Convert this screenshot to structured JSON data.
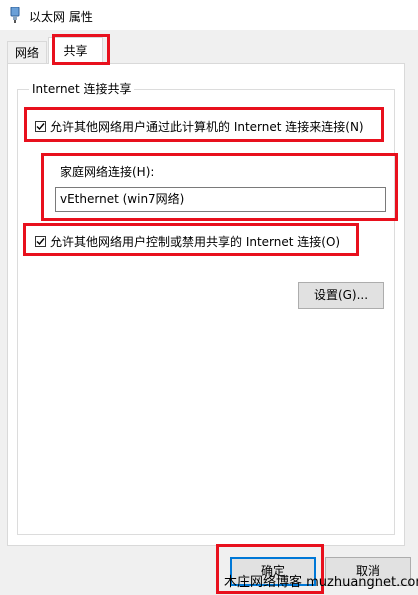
{
  "window": {
    "title": "以太网 属性"
  },
  "tabs": [
    {
      "label": "网络"
    },
    {
      "label": "共享"
    }
  ],
  "sharing": {
    "group_title": "Internet 连接共享",
    "allow_share_label": "允许其他网络用户通过此计算机的 Internet 连接来连接(N)",
    "home_network_label": "家庭网络连接(H):",
    "home_network_value": "vEthernet (win7网络)",
    "allow_control_label": "允许其他网络用户控制或禁用共享的 Internet 连接(O)",
    "settings_button": "设置(G)..."
  },
  "footer": {
    "ok_button": "确定",
    "cancel_button": "取消"
  },
  "watermark": "木庄网络博客 muzhuangnet.com",
  "colors": {
    "highlight": "#e8101d",
    "focus_border": "#0078d7"
  },
  "icons": {
    "app": "network-adapter-icon",
    "check": "checkmark-icon"
  }
}
